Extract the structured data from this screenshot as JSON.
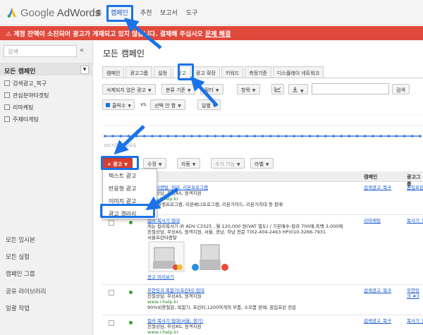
{
  "header": {
    "logo_google": "Google",
    "logo_product": "AdWords",
    "nav": [
      "홈",
      "캠페인",
      "추천",
      "보고서",
      "도구"
    ],
    "active_nav": "캠페인"
  },
  "alert": {
    "text": "계정 잔액이 소진되어 광고가 게재되고 있지 않습니다. 결제해 주십시오",
    "link": "문제 해결"
  },
  "sidebar": {
    "search_placeholder": "검색",
    "collapse_label": "«",
    "all_campaigns": "모든 캠페인",
    "campaigns": [
      "검색광고_복구",
      "관심분야타겟팅",
      "리마케팅",
      "주제타게팅"
    ],
    "footer": [
      "모든 임시본",
      "모든 실험",
      "캠페인 그룹",
      "공유 라이브러리",
      "일괄 작업"
    ]
  },
  "main": {
    "title": "모든 캠페인",
    "tabs": [
      "캠페인",
      "광고그룹",
      "설정",
      "광고",
      "광고 확장",
      "키워드",
      "측정기준",
      "디스플레이 네트워크"
    ],
    "active_tab": "광고",
    "toolbar": {
      "filter_status": "삭제되지 않은 광고",
      "segment": "분류 기준",
      "filter": "필터",
      "columns": "항목",
      "chart_icon": "line-chart-icon",
      "download_icon": "download-icon",
      "search_button": "검색"
    },
    "chart_controls": {
      "metric": "클릭수",
      "vs": "vs.",
      "compare": "선택 안 함",
      "period": "일별"
    },
    "chart_data": {
      "type": "line",
      "values": [
        0,
        0,
        0,
        0,
        0,
        0,
        0,
        0,
        0,
        0,
        0,
        0,
        0,
        0,
        0,
        0,
        0,
        0,
        0,
        0,
        0,
        0,
        0,
        0,
        0,
        0,
        0,
        0,
        0,
        0,
        0,
        0,
        0,
        0,
        0,
        0,
        0,
        0,
        0,
        0,
        0
      ],
      "start_label": "2017년 4월 일요일"
    },
    "actions": {
      "new_ad": "+ 광고",
      "edit": "수정",
      "automate": "자동",
      "more": "추가 기능",
      "label": "라벨"
    },
    "dropdown": [
      "텍스트 광고",
      "반응형 광고",
      "이미지 광고",
      "광고 갤러리"
    ],
    "table": {
      "headers": [
        "캠페인",
        "광고그룹"
      ],
      "rows": [
        {
          "lines": [
            "프린터렌탈, 임대, 리본프로그램",
            "친절상담, 무상AS, 원격지원",
            "www.i-help.kr",
            "리본 플랫프로그램, 리본베너프로그램, 리본가이드, 리본거치대 등 판매"
          ],
          "campaign": "검색광고_복구",
          "group": "꿈집프린"
        },
        {
          "lines": [
            "컬러 복사기 임대",
            "캐논 컬러복사기 iR ADV C3325 , 월 120,000 원(VAT 별도) / 기본매수-칼라 700매,흑백 3,000매",
            "친절상담, 무상AS, 원격지원, 서울, 경남, 하남 전문 T)02-404-2463 HP)010-3266-7931",
            "서울프린터렌탈"
          ],
          "preview": "광고 미리보기",
          "campaign": "리마케팅",
          "group": "복사기_임"
        },
        {
          "lines": [
            "무한잉크 복합기(프린터) 임대",
            "친절상담, 무상AS, 원격지원",
            "www.i-help.kr",
            "90%비용절감, 복합기, 프린터,1200여개의 부품, 소모품 판매, 꿈집프린 전문"
          ],
          "campaign": "검색광고_복구",
          "group": "무한잉크 #3"
        },
        {
          "lines": [
            "컬러 복사기 임대(서울, 경기)",
            "친절상담, 무상AS, 원격지원",
            "www.i-help.kr"
          ],
          "campaign": "검색광고_복구",
          "group": "복사기_임"
        }
      ]
    }
  }
}
